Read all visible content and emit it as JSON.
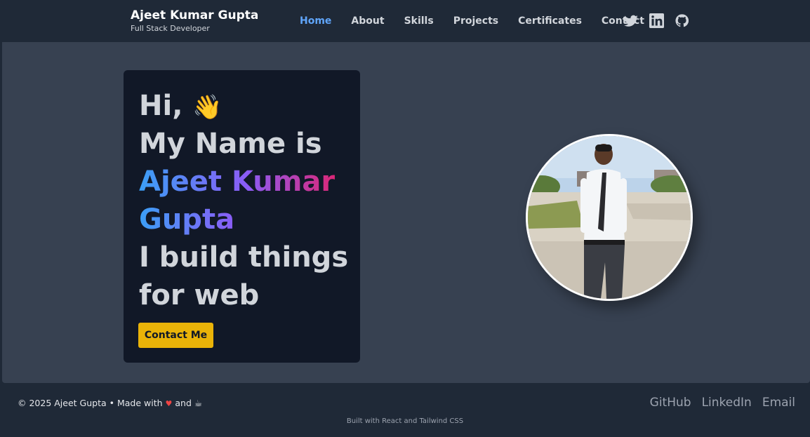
{
  "header": {
    "name": "Ajeet Kumar Gupta",
    "role": "Full Stack Developer",
    "nav": [
      "Home",
      "About",
      "Skills",
      "Projects",
      "Certificates",
      "Contact"
    ],
    "active_nav": "Home",
    "socials": [
      "twitter-icon",
      "linkedin-icon",
      "github-icon"
    ]
  },
  "hero": {
    "greeting": "Hi,",
    "wave": "👋",
    "intro": "My Name is",
    "name_line1_first": "Ajeet",
    "name_line1_second": "Kumar",
    "name_line2": "Gupta",
    "tagline_line1": "I build things",
    "tagline_line2": "for web",
    "cta": "Contact Me"
  },
  "footer": {
    "copyright_prefix": "© 2025 Ajeet Gupta • Made with",
    "heart": "♥",
    "and": "and",
    "coffee": "☕",
    "links": [
      "GitHub",
      "LinkedIn",
      "Email"
    ],
    "built_with": "Built with React and Tailwind CSS"
  },
  "colors": {
    "header_bg": "#1f2937",
    "main_bg": "#374151",
    "card_bg": "#111827",
    "active_nav": "#60a5fa",
    "cta_bg": "#eab308"
  }
}
